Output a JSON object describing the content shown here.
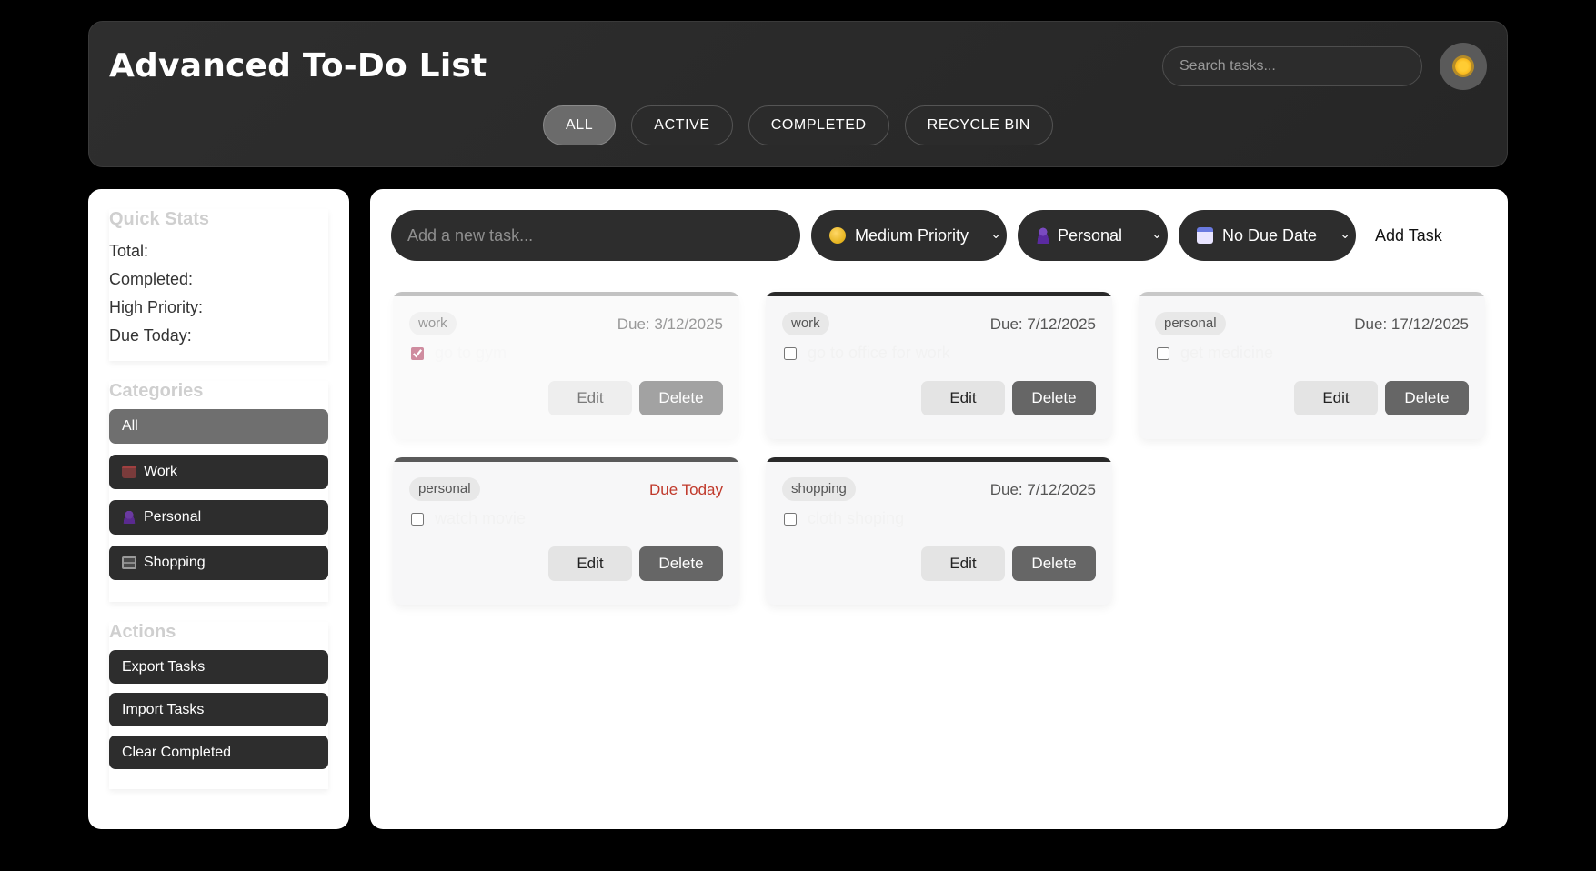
{
  "header": {
    "title": "Advanced To-Do List",
    "search_placeholder": "Search tasks...",
    "theme_icon": "sun-icon",
    "filters": [
      "ALL",
      "ACTIVE",
      "COMPLETED",
      "RECYCLE BIN"
    ],
    "active_filter": "ALL"
  },
  "sidebar": {
    "stats": {
      "heading": "Quick Stats",
      "total": "Total:",
      "completed": "Completed:",
      "high_priority": "High Priority:",
      "due_today": "Due Today:"
    },
    "categories": {
      "heading": "Categories",
      "items": [
        "All",
        "Work",
        "Personal",
        "Shopping"
      ],
      "icons": [
        "",
        "briefcase-icon",
        "person-icon",
        "shopping-cart-icon"
      ]
    },
    "actions": {
      "heading": "Actions",
      "items": [
        "Export Tasks",
        "Import Tasks",
        "Clear Completed"
      ]
    }
  },
  "composer": {
    "placeholder": "Add a new task...",
    "priority": "Medium Priority",
    "category": "Personal",
    "due": "No Due Date",
    "add_label": "Add Task"
  },
  "colors": {
    "due_today": "#c0392b",
    "priority_medium": "#d9a400"
  },
  "tasks": [
    {
      "tag": "work",
      "due": "Due: 3/12/2025",
      "text": "go to gym",
      "done": true,
      "bar": "#9a9a9a"
    },
    {
      "tag": "work",
      "due": "Due: 7/12/2025",
      "text": "go to office for work",
      "done": false,
      "bar": "#2a2a2a"
    },
    {
      "tag": "personal",
      "due": "Due: 17/12/2025",
      "text": "get medicine",
      "done": false,
      "bar": "#c8c8c8"
    },
    {
      "tag": "personal",
      "due": "Due Today",
      "text": "watch movie",
      "done": false,
      "bar": "#5a5a5a",
      "due_today": true
    },
    {
      "tag": "shopping",
      "due": "Due: 7/12/2025",
      "text": "cloth shoping",
      "done": false,
      "bar": "#2a2a2a"
    }
  ],
  "card_labels": {
    "edit": "Edit",
    "delete": "Delete"
  }
}
